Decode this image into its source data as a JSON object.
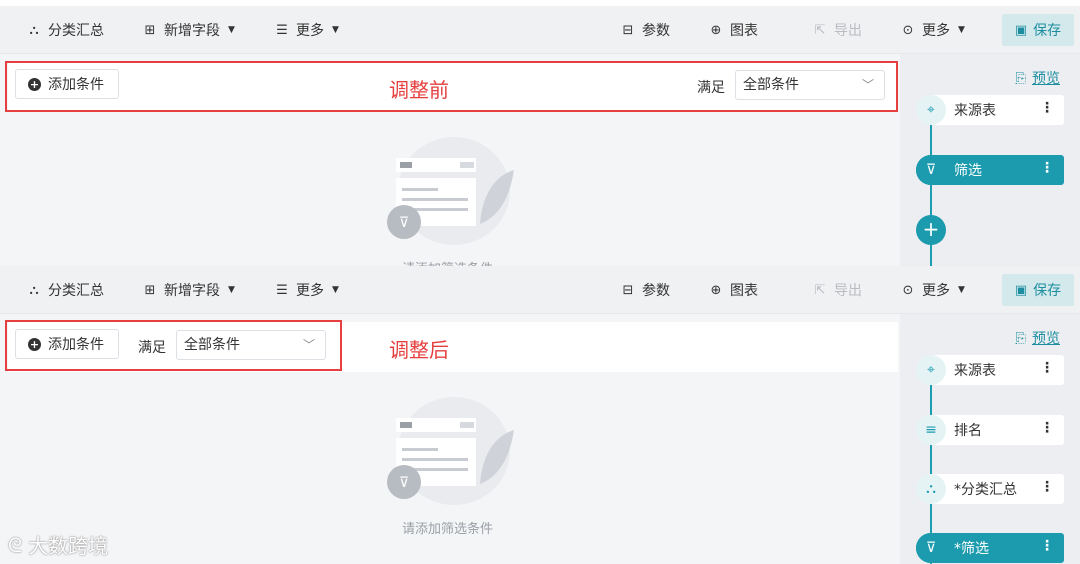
{
  "toolbar": {
    "classify_summary": "分类汇总",
    "add_field": "新增字段",
    "more_left": "更多",
    "params": "参数",
    "chart": "图表",
    "export": "导出",
    "more_right": "更多",
    "save": "保存"
  },
  "filter": {
    "add_condition": "添加条件",
    "satisfy_label": "满足",
    "condition_value": "全部条件"
  },
  "annotations": {
    "before": "调整前",
    "after": "调整后"
  },
  "empty_state": {
    "text": "请添加筛选条件",
    "text_partial": "请添加筛选条件"
  },
  "side_panel": {
    "preview": "预览",
    "before_nodes": [
      {
        "label": "来源表",
        "icon": "crosshair-icon",
        "active": false
      },
      {
        "label": "筛选",
        "icon": "filter-icon",
        "active": true
      }
    ],
    "after_nodes": [
      {
        "label": "来源表",
        "icon": "crosshair-icon",
        "active": false
      },
      {
        "label": "排名",
        "icon": "rank-icon",
        "active": false
      },
      {
        "label": "*分类汇总",
        "icon": "hierarchy-icon",
        "active": false
      },
      {
        "label": "*筛选",
        "icon": "filter-icon",
        "active": true
      }
    ]
  },
  "watermark": "大数跨境",
  "colors": {
    "accent": "#1b9bad",
    "annotation_red": "#e5403f",
    "save_bg": "#d3e9ec"
  }
}
